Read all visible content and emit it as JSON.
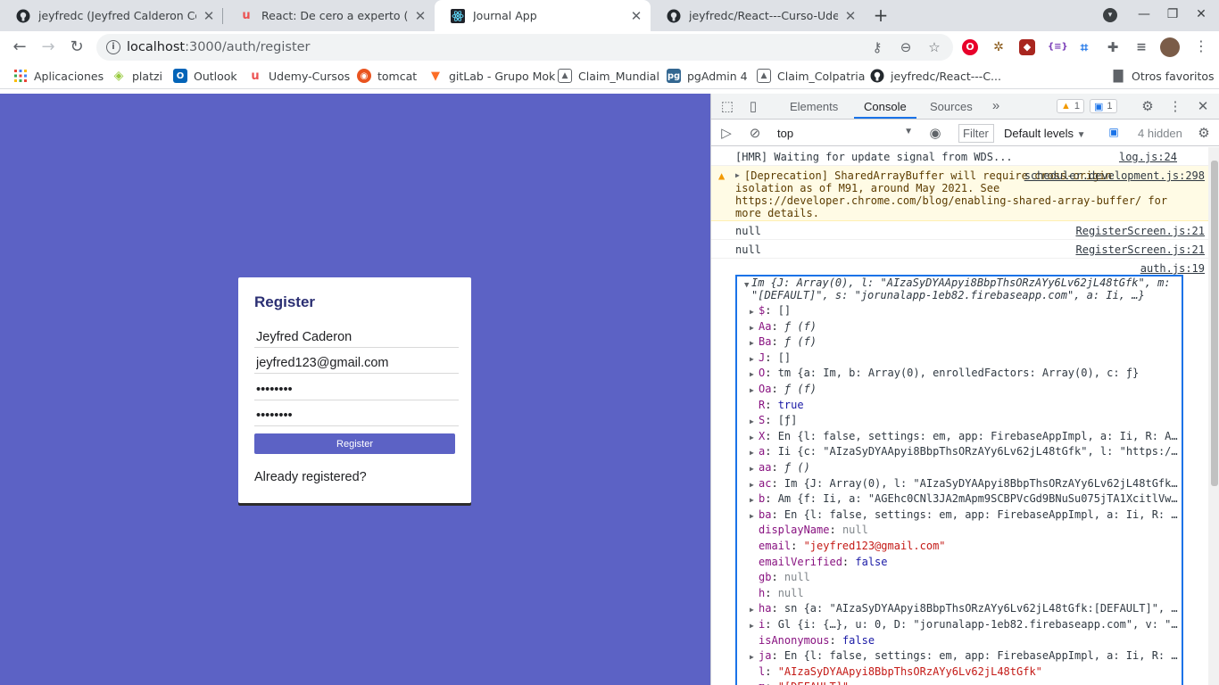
{
  "tabs": [
    {
      "title": "jeyfredc (Jeyfred Calderon Corte",
      "icon": "github-icon"
    },
    {
      "title": "React: De cero a experto ( Hooks",
      "icon": "udemy-icon"
    },
    {
      "title": "Journal App",
      "icon": "react-icon"
    },
    {
      "title": "jeyfredc/React---Curso-Udemy",
      "icon": "github-icon"
    }
  ],
  "address": {
    "host": "localhost",
    "path": ":3000/auth/register"
  },
  "bookmarks": [
    {
      "label": "Aplicaciones",
      "icon": "apps-grid-icon"
    },
    {
      "label": "platzi",
      "icon": "platzi-icon"
    },
    {
      "label": "Outlook",
      "icon": "outlook-icon"
    },
    {
      "label": "Udemy-Cursos",
      "icon": "udemy-icon"
    },
    {
      "label": "tomcat",
      "icon": "ubuntu-icon"
    },
    {
      "label": "gitLab - Grupo Mok",
      "icon": "gitlab-icon"
    },
    {
      "label": "Claim_Mundial",
      "icon": "image-icon"
    },
    {
      "label": "pgAdmin 4",
      "icon": "pgadmin-icon"
    },
    {
      "label": "Claim_Colpatria",
      "icon": "image-icon"
    },
    {
      "label": "jeyfredc/React---C...",
      "icon": "github-icon"
    },
    {
      "label": "Otros favoritos",
      "icon": "folder-icon"
    }
  ],
  "form": {
    "title": "Register",
    "name_value": "Jeyfred Caderon",
    "email_value": "jeyfred123@gmail.com",
    "password_value": "••••••••",
    "password2_value": "••••••••",
    "button_label": "Register",
    "link_label": "Already registered?"
  },
  "devtools": {
    "tabs": [
      "Elements",
      "Console",
      "Sources"
    ],
    "active_tab": "Console",
    "warn_count": "1",
    "msg_count": "1",
    "context": "top",
    "filter_placeholder": "Filter",
    "levels": "Default levels",
    "hidden": "4 hidden"
  },
  "console": {
    "msg1": {
      "text": "[HMR] Waiting for update signal from WDS...",
      "src": "log.js:24"
    },
    "warn": {
      "text": "[Deprecation] SharedArrayBuffer will require cross-origin isolation as of M91, around May 2021. See https://developer.chrome.com/blog/enabling-shared-array-buffer/ for more details.",
      "src": "scheduler.development.js:298"
    },
    "msg3": {
      "text": "null",
      "src": "RegisterScreen.js:21"
    },
    "msg4": {
      "text": "null",
      "src": "RegisterScreen.js:21"
    },
    "msg5_src": "auth.js:19",
    "obj_head": "Im {J: Array(0), l: \"AIzaSyDYAApyi8BbpThsORzAYy6Lv62jL48tGfk\", m: \"[DEFAULT]\", s: \"jorunalapp-1eb82.firebaseapp.com\", a: Ii, …}",
    "props": [
      {
        "k": "$",
        "v": "[]",
        "exp": true
      },
      {
        "k": "Aa",
        "v": "ƒ (f)",
        "exp": true
      },
      {
        "k": "Ba",
        "v": "ƒ (f)",
        "exp": true
      },
      {
        "k": "J",
        "v": "[]",
        "exp": true
      },
      {
        "k": "O",
        "v": "tm {a: Im, b: Array(0), enrolledFactors: Array(0), c: ƒ}",
        "exp": true
      },
      {
        "k": "Oa",
        "v": "ƒ (f)",
        "exp": true
      },
      {
        "k": "R",
        "v": "true",
        "exp": false
      },
      {
        "k": "S",
        "v": "[ƒ]",
        "exp": true
      },
      {
        "k": "X",
        "v": "En {l: false, settings: em, app: FirebaseAppImpl, a: Ii, R: A…",
        "exp": true
      },
      {
        "k": "a",
        "v": "Ii {c: \"AIzaSyDYAApyi8BbpThsORzAYy6Lv62jL48tGfk\", l: \"https:/…",
        "exp": true
      },
      {
        "k": "aa",
        "v": "ƒ ()",
        "exp": true
      },
      {
        "k": "ac",
        "v": "Im {J: Array(0), l: \"AIzaSyDYAApyi8BbpThsORzAYy6Lv62jL48tGfk…",
        "exp": true
      },
      {
        "k": "b",
        "v": "Am {f: Ii, a: \"AGEhc0CNl3JA2mApm9SCBPVcGd9BNuSu075jTA1XcitlVw…",
        "exp": true
      },
      {
        "k": "ba",
        "v": "En {l: false, settings: em, app: FirebaseAppImpl, a: Ii, R: …",
        "exp": true
      },
      {
        "k": "displayName",
        "v": "null",
        "exp": false
      },
      {
        "k": "email",
        "v": "\"jeyfred123@gmail.com\"",
        "exp": false
      },
      {
        "k": "emailVerified",
        "v": "false",
        "exp": false
      },
      {
        "k": "gb",
        "v": "null",
        "exp": false
      },
      {
        "k": "h",
        "v": "null",
        "exp": false
      },
      {
        "k": "ha",
        "v": "sn {a: \"AIzaSyDYAApyi8BbpThsORzAYy6Lv62jL48tGfk:[DEFAULT]\", …",
        "exp": true
      },
      {
        "k": "i",
        "v": "Gl {i: {…}, u: 0, D: \"jorunalapp-1eb82.firebaseapp.com\", v: \"…",
        "exp": true
      },
      {
        "k": "isAnonymous",
        "v": "false",
        "exp": false
      },
      {
        "k": "ja",
        "v": "En {l: false, settings: em, app: FirebaseAppImpl, a: Ii, R: …",
        "exp": true
      },
      {
        "k": "l",
        "v": "\"AIzaSyDYAApyi8BbpThsORzAYy6Lv62jL48tGfk\"",
        "exp": false
      },
      {
        "k": "m",
        "v": "\"[DEFAULT]\"",
        "exp": false
      }
    ]
  },
  "colors": {
    "page_bg": "#5c62c5",
    "accent": "#1a73e8"
  }
}
